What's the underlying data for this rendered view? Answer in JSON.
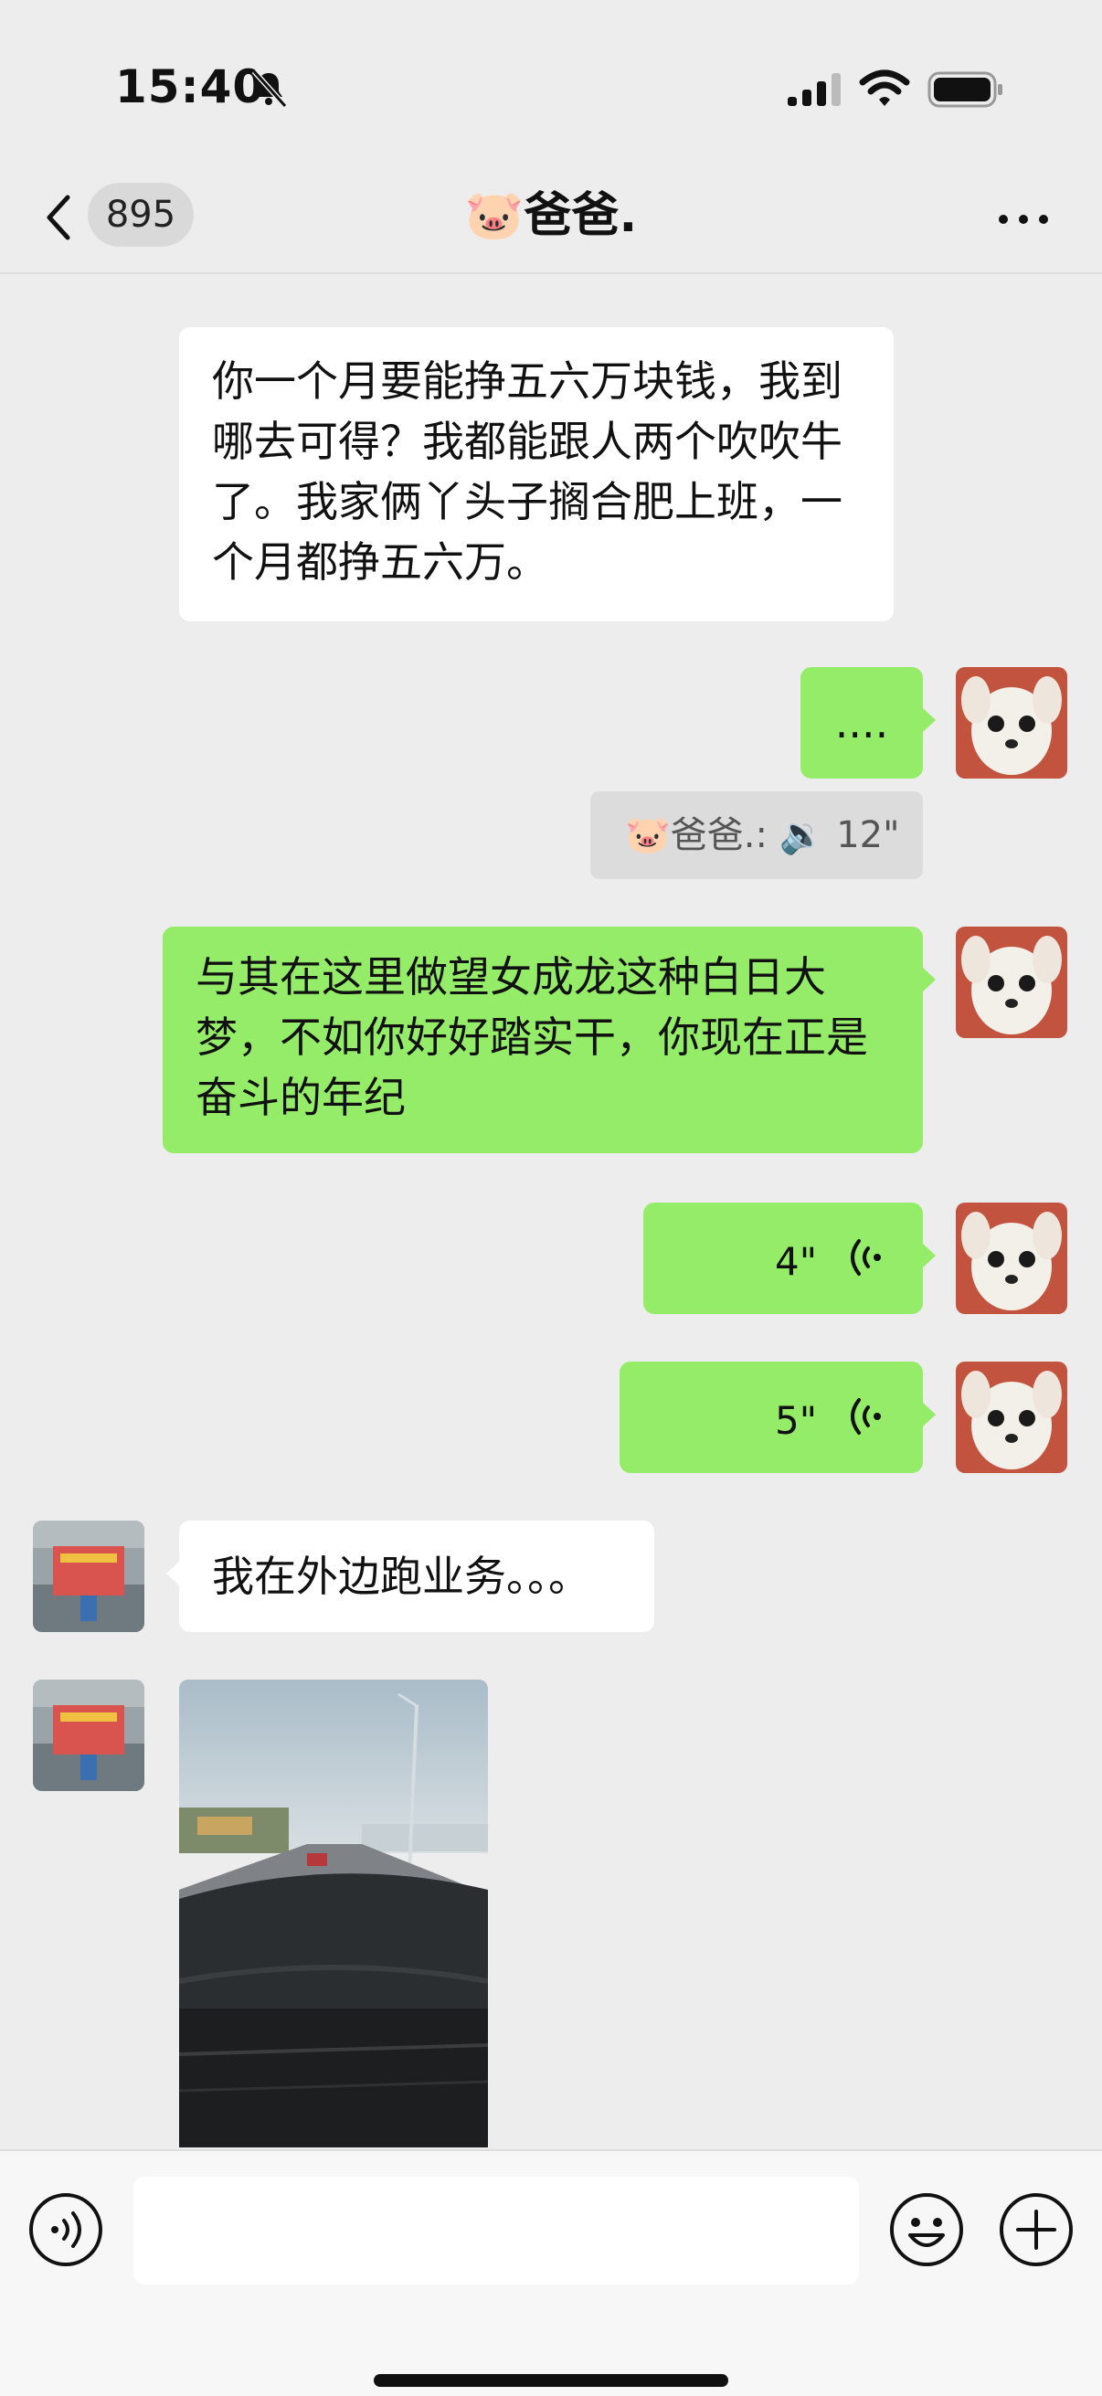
{
  "status_bar": {
    "time": "15:40",
    "icons": [
      "bell-muted-icon",
      "signal-icon",
      "wifi-icon",
      "battery-icon"
    ]
  },
  "nav": {
    "back_icon": "chevron-left-icon",
    "unread_count": "895",
    "title": "🐷爸爸.",
    "more_icon": "more-dots-icon"
  },
  "messages": [
    {
      "side": "left",
      "type": "text",
      "text": "你一个月要能挣五六万块钱，我到哪去可得？我都能跟人两个吹吹牛了。我家俩丫头子搁合肥上班，一个月都挣五六万。"
    },
    {
      "side": "right",
      "type": "text",
      "text": "...."
    },
    {
      "side": "right",
      "type": "quote",
      "text": "🐷爸爸.: 🔉 12\""
    },
    {
      "side": "right",
      "type": "text",
      "text": "与其在这里做望女成龙这种白日大梦，不如你好好踏实干，你现在正是奋斗的年纪"
    },
    {
      "side": "right",
      "type": "voice",
      "duration": "4\""
    },
    {
      "side": "right",
      "type": "voice",
      "duration": "5\""
    },
    {
      "side": "left",
      "type": "text",
      "text": "我在外边跑业务。。。"
    },
    {
      "side": "left",
      "type": "image",
      "image": "car-dashboard-road-photo"
    }
  ],
  "input_bar": {
    "voice_icon": "voice-input-icon",
    "placeholder": "",
    "emoji_icon": "emoji-icon",
    "plus_icon": "plus-icon"
  },
  "colors": {
    "background": "#ededed",
    "bubble_self": "#95ec69",
    "bubble_other": "#ffffff"
  }
}
